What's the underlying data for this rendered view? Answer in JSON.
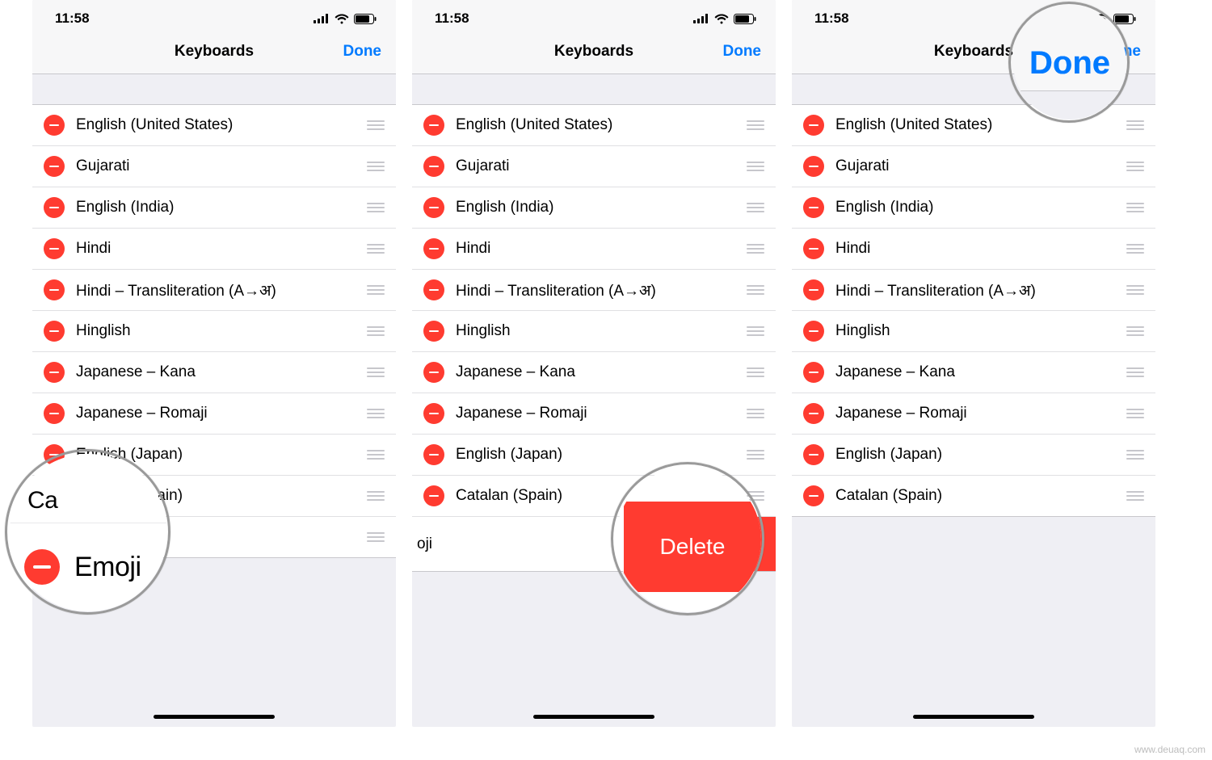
{
  "status": {
    "time": "11:58"
  },
  "nav": {
    "title": "Keyboards",
    "done": "Done"
  },
  "keyboards_full": [
    "English (United States)",
    "Gujarati",
    "English (India)",
    "Hindi",
    "Hindi – Transliteration (A→अ)",
    "Hinglish",
    "Japanese – Kana",
    "Japanese – Romaji",
    "English (Japan)",
    "Catalan (Spain)"
  ],
  "phone1_extra_rows": [
    "English (Japan)",
    "Catalan (Spain)",
    "Emoji"
  ],
  "phone2_last": {
    "visible_text": "oji",
    "delete_label": "Delete"
  },
  "phone3_keyboards": [
    "English (United States)",
    "Gujarati",
    "English (India)",
    "Hindi",
    "Hindi – Transliteration (A→अ)",
    "Hinglish",
    "Japanese – Kana",
    "Japanese – Romaji",
    "English (Japan)",
    "Catalan (Spain)"
  ],
  "callouts": {
    "emoji_label": "Emoji",
    "delete_label": "Delete",
    "done_label": "Done"
  },
  "watermark": "www.deuaq.com"
}
